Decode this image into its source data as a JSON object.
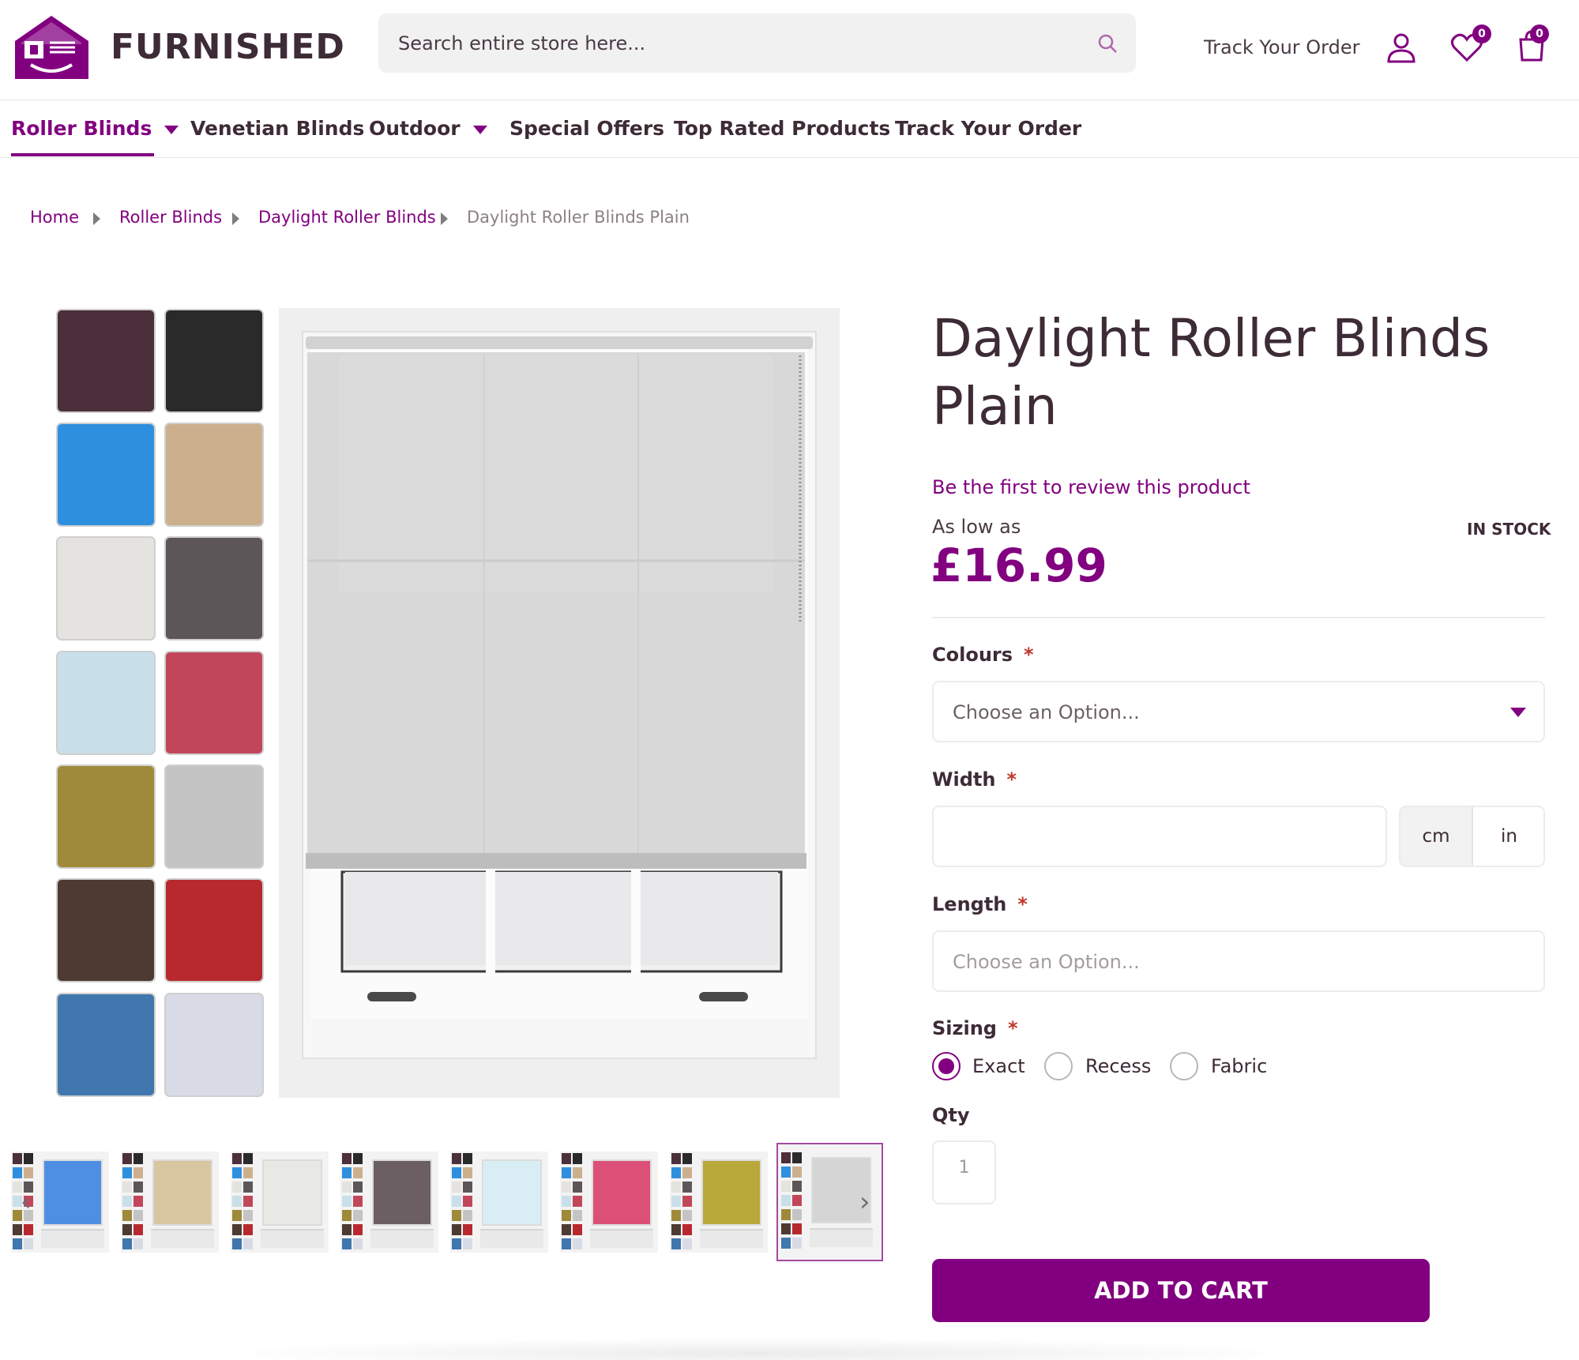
{
  "header": {
    "brand": "FURNISHED",
    "search_placeholder": "Search entire store here...",
    "track_order": "Track Your Order",
    "wishlist_count": "0",
    "cart_count": "0",
    "accent_color": "#820080"
  },
  "nav": {
    "items": [
      {
        "label": "Roller Blinds",
        "dropdown": true,
        "active": true
      },
      {
        "label": "Venetian Blinds",
        "dropdown": false,
        "active": false
      },
      {
        "label": "Outdoor",
        "dropdown": true,
        "active": false
      },
      {
        "label": "Special Offers",
        "dropdown": false,
        "active": false
      },
      {
        "label": "Top Rated Products",
        "dropdown": false,
        "active": false
      },
      {
        "label": "Track Your Order",
        "dropdown": false,
        "active": false
      }
    ]
  },
  "breadcrumb": [
    "Home",
    "Roller Blinds",
    "Daylight Roller Blinds",
    "Daylight Roller Blinds Plain"
  ],
  "gallery": {
    "swatch_colors": [
      "#4b2f3b",
      "#2a2a2a",
      "#2f8fdf",
      "#ccb08e",
      "#e4e3df",
      "#5d5658",
      "#c9dfe9",
      "#c2465a",
      "#9e8a39",
      "#c4c4c4",
      "#4d3a31",
      "#b7292e",
      "#3f77ae",
      "#d8dbe6"
    ],
    "thumbnail_colors": [
      "#4f8fe3",
      "#d8c6a0",
      "#e8e8e4",
      "#6b5f63",
      "#d9edf5",
      "#dc4f77",
      "#b9a83a",
      "#d5d5d5"
    ]
  },
  "product": {
    "title": "Daylight Roller Blinds Plain",
    "review_link": "Be the first to review this product",
    "as_low_as": "As low as",
    "price": "£16.99",
    "stock": "IN STOCK",
    "colours_label": "Colours",
    "colours_placeholder": "Choose an Option...",
    "width_label": "Width",
    "width_value": "",
    "unit_cm": "cm",
    "unit_in": "in",
    "length_label": "Length",
    "length_placeholder": "Choose an Option...",
    "sizing_label": "Sizing",
    "sizing_options": [
      "Exact",
      "Recess",
      "Fabric"
    ],
    "sizing_selected": "Exact",
    "qty_label": "Qty",
    "qty_value": "1",
    "required_mark": "*",
    "add_to_cart": "ADD TO CART"
  }
}
